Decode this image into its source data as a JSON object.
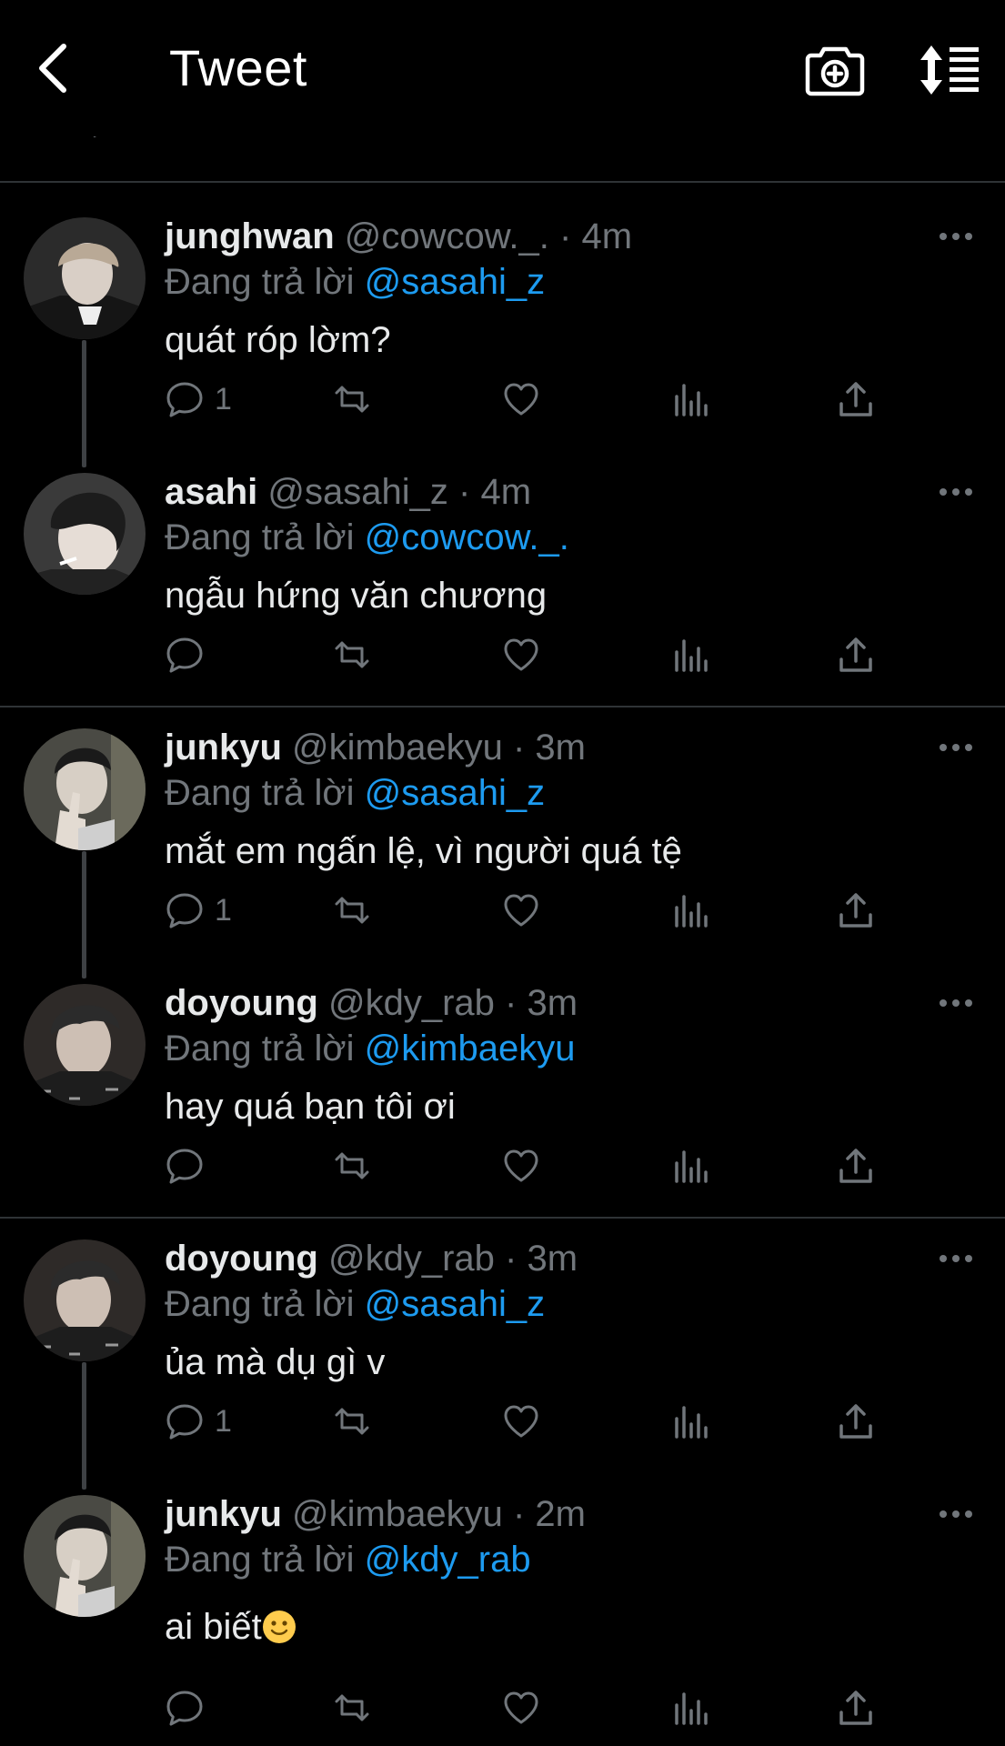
{
  "header": {
    "title": "Tweet",
    "back_icon": "chevron-left-icon",
    "camera_icon": "camera-plus-icon",
    "sort_icon": "sort-arrows-icon"
  },
  "colors": {
    "background": "#000000",
    "text": "#e7e9ea",
    "secondary": "#71767b",
    "accent": "#1d9bf0",
    "divider": "#2f3336"
  },
  "tweets": [
    {
      "name": "junghwan",
      "handle": "@cowcow._.",
      "sep": "·",
      "time": "4m",
      "reply_prefix": "Đang trả lời",
      "reply_to": "@sasahi_z",
      "text": "quát róp lờm?",
      "reply_count": "1"
    },
    {
      "name": "asahi",
      "handle": "@sasahi_z",
      "sep": "·",
      "time": "4m",
      "reply_prefix": "Đang trả lời",
      "reply_to": "@cowcow._.",
      "text": "ngẫu hứng văn chương",
      "reply_count": ""
    },
    {
      "name": "junkyu",
      "handle": "@kimbaekyu",
      "sep": "·",
      "time": "3m",
      "reply_prefix": "Đang trả lời",
      "reply_to": "@sasahi_z",
      "text": "mắt em ngấn lệ, vì người quá tệ",
      "reply_count": "1"
    },
    {
      "name": "doyoung",
      "handle": "@kdy_rab",
      "sep": "·",
      "time": "3m",
      "reply_prefix": "Đang trả lời",
      "reply_to": "@kimbaekyu",
      "text": "hay quá bạn tôi ơi",
      "reply_count": ""
    },
    {
      "name": "doyoung",
      "handle": "@kdy_rab",
      "sep": "·",
      "time": "3m",
      "reply_prefix": "Đang trả lời",
      "reply_to": "@sasahi_z",
      "text": "ủa mà dụ gì v",
      "reply_count": "1"
    },
    {
      "name": "junkyu",
      "handle": "@kimbaekyu",
      "sep": "·",
      "time": "2m",
      "reply_prefix": "Đang trả lời",
      "reply_to": "@kdy_rab",
      "text": "ai biết",
      "text_emoji": "slightly-smiling-face-emoji",
      "reply_count": ""
    }
  ]
}
